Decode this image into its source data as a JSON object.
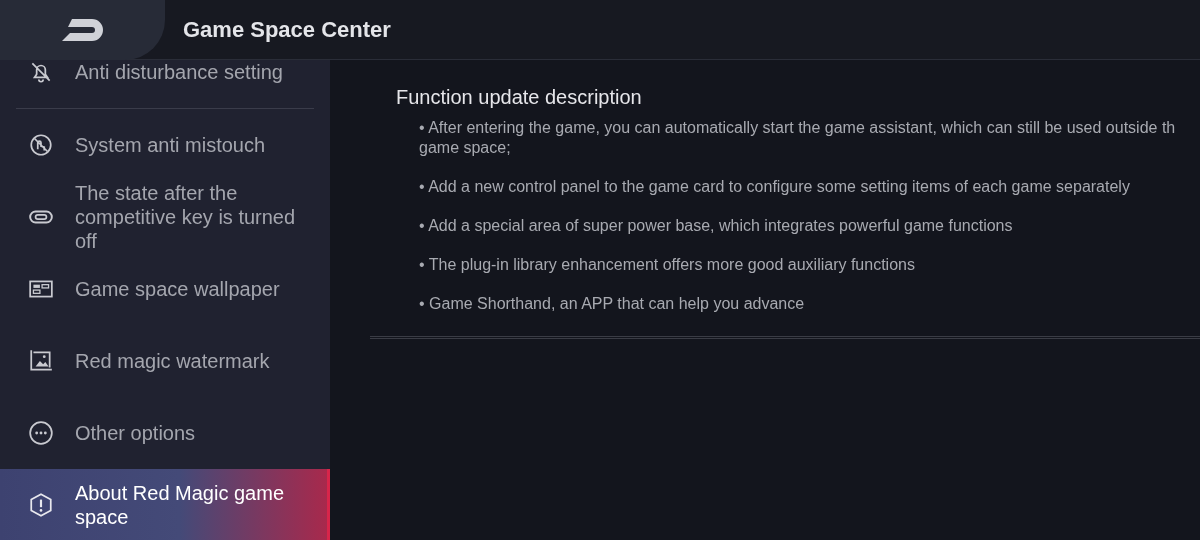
{
  "header": {
    "title": "Game Space Center"
  },
  "sidebar": {
    "items": [
      {
        "label": "Anti disturbance setting",
        "selected": false
      },
      {
        "label": "System anti mistouch",
        "selected": false
      },
      {
        "label": "The state after the competitive key is turned off",
        "selected": false
      },
      {
        "label": "Game space wallpaper",
        "selected": false
      },
      {
        "label": "Red magic watermark",
        "selected": false
      },
      {
        "label": "Other options",
        "selected": false
      },
      {
        "label": "About Red Magic game space",
        "selected": true
      }
    ]
  },
  "content": {
    "title": "Function update description",
    "items": [
      {
        "lines": [
          "• After entering the game, you can automatically start the game assistant, which can still be used outside th",
          "game space;"
        ]
      },
      {
        "lines": [
          "• Add a new control panel to the game card to configure some setting items of each game separately"
        ]
      },
      {
        "lines": [
          "• Add a special area of super power base, which integrates powerful game functions"
        ]
      },
      {
        "lines": [
          "• The plug-in library enhancement offers more good auxiliary functions"
        ]
      },
      {
        "lines": [
          "• Game Shorthand, an APP that can help you advance"
        ]
      }
    ]
  }
}
